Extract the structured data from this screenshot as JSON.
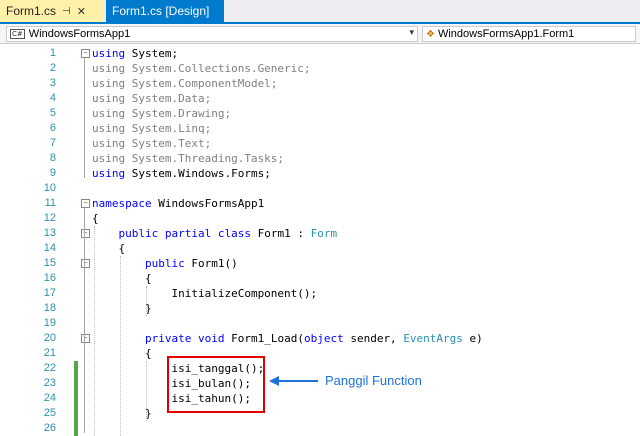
{
  "tabs": [
    {
      "label": "Form1.cs",
      "pin_icon": "pin-icon",
      "close_icon": "close-icon"
    },
    {
      "label": "Form1.cs [Design]"
    }
  ],
  "nav": {
    "project": "WindowsFormsApp1",
    "project_badge": "C#",
    "class": "WindowsFormsApp1.Form1"
  },
  "code_lines": [
    {
      "n": "1",
      "text": "using System;"
    },
    {
      "n": "2",
      "text": "using System.Collections.Generic;"
    },
    {
      "n": "3",
      "text": "using System.ComponentModel;"
    },
    {
      "n": "4",
      "text": "using System.Data;"
    },
    {
      "n": "5",
      "text": "using System.Drawing;"
    },
    {
      "n": "6",
      "text": "using System.Linq;"
    },
    {
      "n": "7",
      "text": "using System.Text;"
    },
    {
      "n": "8",
      "text": "using System.Threading.Tasks;"
    },
    {
      "n": "9",
      "text": "using System.Windows.Forms;"
    },
    {
      "n": "10",
      "text": ""
    },
    {
      "n": "11",
      "text": "namespace WindowsFormsApp1"
    },
    {
      "n": "12",
      "text": "{"
    },
    {
      "n": "13",
      "text": "    public partial class Form1 : Form"
    },
    {
      "n": "14",
      "text": "    {"
    },
    {
      "n": "15",
      "text": "        public Form1()"
    },
    {
      "n": "16",
      "text": "        {"
    },
    {
      "n": "17",
      "text": "            InitializeComponent();"
    },
    {
      "n": "18",
      "text": "        }"
    },
    {
      "n": "19",
      "text": ""
    },
    {
      "n": "20",
      "text": "        private void Form1_Load(object sender, EventArgs e)"
    },
    {
      "n": "21",
      "text": "        {"
    },
    {
      "n": "22",
      "text": "            isi_tanggal();"
    },
    {
      "n": "23",
      "text": "            isi_bulan();"
    },
    {
      "n": "24",
      "text": "            isi_tahun();"
    },
    {
      "n": "25",
      "text": "        }"
    },
    {
      "n": "26",
      "text": ""
    }
  ],
  "annotation": "Panggil Function",
  "colors": {
    "keyword": "#0000ff",
    "type": "#2b91af",
    "line_number": "#2b91af",
    "highlight_box": "#e00000",
    "annotation": "#1e73d8",
    "active_tab": "#fff1a8",
    "accent": "#007acc",
    "change_bar": "#57a64a"
  }
}
